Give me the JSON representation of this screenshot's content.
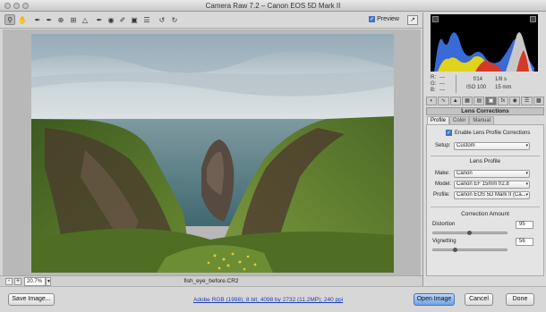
{
  "window": {
    "title": "Camera Raw 7.2 – Canon EOS 5D Mark II"
  },
  "toolbar": {
    "tools": [
      "zoom-icon",
      "hand-icon",
      "white-balance-icon",
      "color-sampler-icon",
      "target-adjust-icon",
      "crop-icon",
      "straighten-icon",
      "spot-removal-icon",
      "red-eye-icon",
      "adjustment-brush-icon",
      "graduated-filter-icon",
      "radial-icon",
      "preferences-icon",
      "rotate-left-icon",
      "rotate-right-icon"
    ],
    "preview_label": "Preview",
    "preview_checked": true
  },
  "status": {
    "zoom_value": "20.7%",
    "filename": "fish_eye_before.CR2"
  },
  "bottom": {
    "save_label": "Save Image...",
    "workflow_link": "Adobe RGB (1998); 8 bit; 4098 by 2732 (11.2MP); 240 ppi",
    "open_label": "Open Image",
    "cancel_label": "Cancel",
    "done_label": "Done"
  },
  "info": {
    "r_label": "R:",
    "g_label": "G:",
    "b_label": "B:",
    "rgb_value": "---",
    "aperture": "f/14",
    "shutter": "1/8 s",
    "iso": "ISO 100",
    "focal": "15 mm"
  },
  "panel": {
    "title": "Lens Corrections",
    "subtabs": [
      "Profile",
      "Color",
      "Manual"
    ],
    "enable_label": "Enable Lens Profile Corrections",
    "enable_checked": true,
    "setup_label": "Setup:",
    "setup_value": "Custom",
    "lens_profile_title": "Lens Profile",
    "make_label": "Make:",
    "make_value": "Canon",
    "model_label": "Model:",
    "model_value": "Canon EF 15mm f/2.8",
    "profile_label": "Profile:",
    "profile_value": "Canon EOS 5D Mark II (Ca...",
    "correction_title": "Correction Amount",
    "distortion_label": "Distortion",
    "distortion_value": "95",
    "vignetting_label": "Vignetting",
    "vignetting_value": "56",
    "distortion_level": 0.95,
    "vignetting_level": 0.56
  },
  "colors": {
    "accent_blue": "#3d79d8",
    "sky": "#c8d2d8",
    "sea": "#5a8088",
    "grass": "#5b7a2c",
    "rock": "#4a3a30"
  }
}
